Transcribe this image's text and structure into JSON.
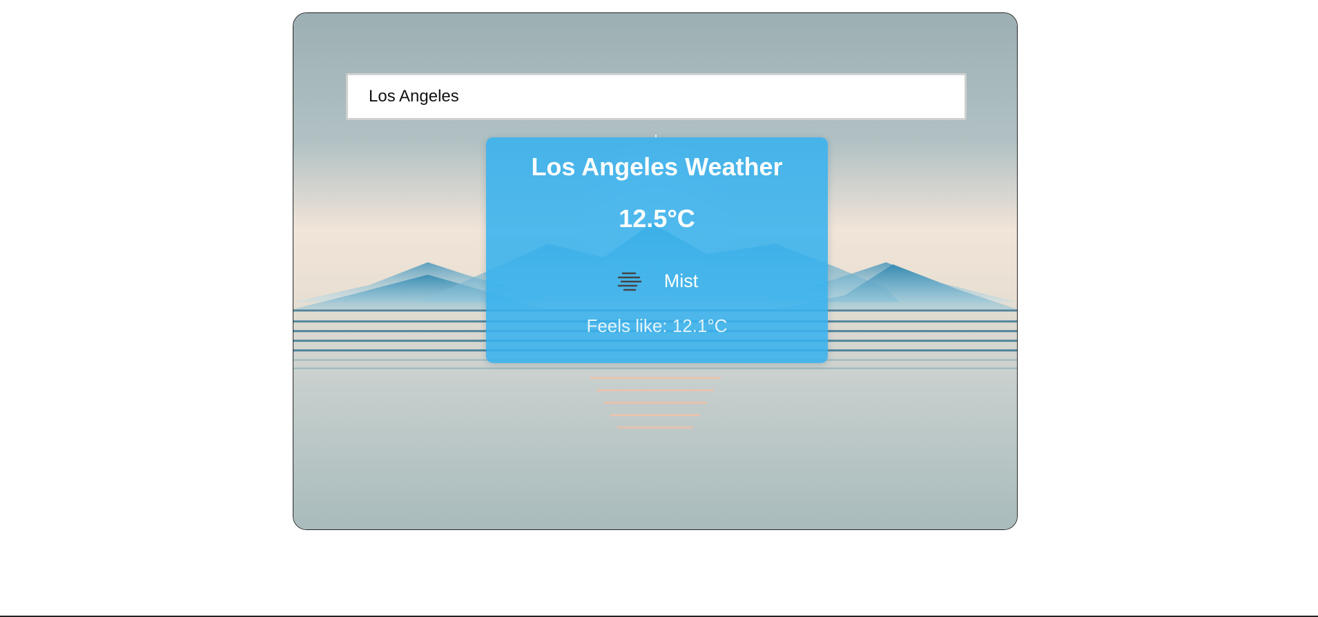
{
  "search": {
    "value": "Los Angeles"
  },
  "weather": {
    "title": "Los Angeles Weather",
    "temperature": "12.5°C",
    "condition": "Mist",
    "condition_icon": "mist-icon",
    "feels_like": "Feels like: 12.1°C"
  },
  "colors": {
    "card_background": "#38b2ee",
    "sky_top": "#9fb1b5",
    "horizon": "#f1e4d8",
    "mountain": "#3a8fb5",
    "water_line": "#2e6f8e"
  }
}
